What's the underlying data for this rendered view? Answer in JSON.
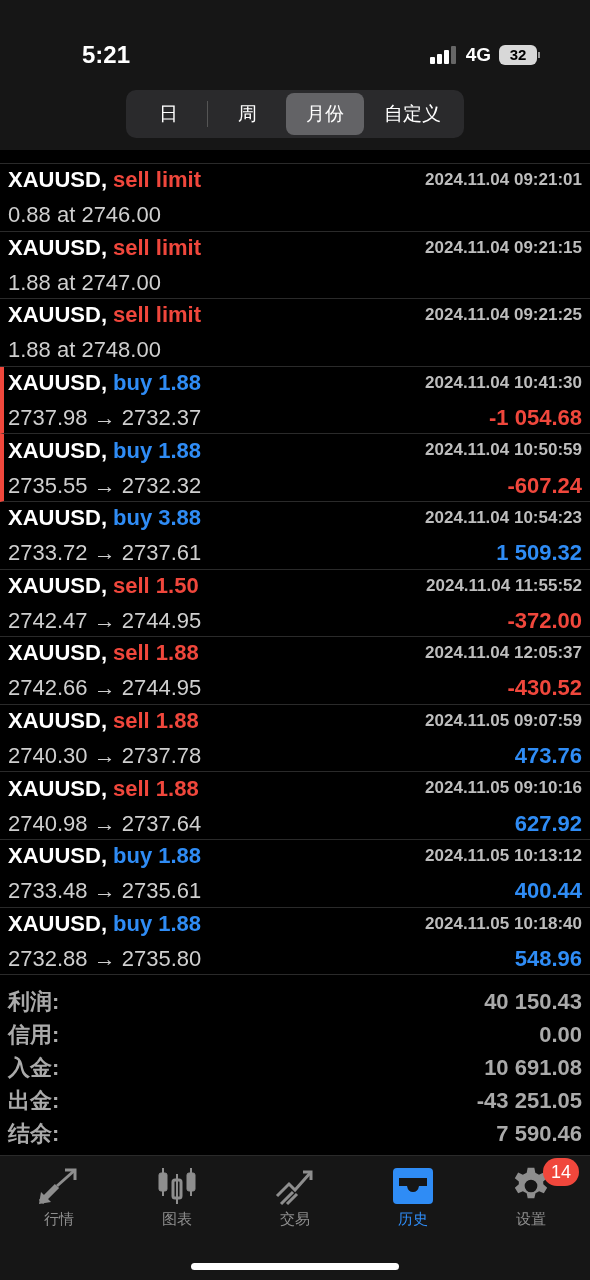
{
  "status_bar": {
    "time": "5:21",
    "network": "4G",
    "battery": "32"
  },
  "period_tabs": [
    {
      "label": "日",
      "selected": false
    },
    {
      "label": "周",
      "selected": false
    },
    {
      "label": "月份",
      "selected": true
    },
    {
      "label": "自定义",
      "selected": false
    }
  ],
  "history": [
    {
      "kind": "order",
      "symbol": "XAUUSD,",
      "action": "sell limit",
      "color": "#f0473c",
      "time": "2024.11.04 09:21:01",
      "detail": "0.88 at 2746.00",
      "flagged": false
    },
    {
      "kind": "order",
      "symbol": "XAUUSD,",
      "action": "sell limit",
      "color": "#f0473c",
      "time": "2024.11.04 09:21:15",
      "detail": "1.88 at 2747.00",
      "flagged": false
    },
    {
      "kind": "order",
      "symbol": "XAUUSD,",
      "action": "sell limit",
      "color": "#f0473c",
      "time": "2024.11.04 09:21:25",
      "detail": "1.88 at 2748.00",
      "flagged": false
    },
    {
      "kind": "deal",
      "symbol": "XAUUSD,",
      "action": "buy 1.88",
      "color": "#2f8cf5",
      "time": "2024.11.04 10:41:30",
      "detail": "2737.98 → 2732.37",
      "profit": "-1 054.68",
      "loss": true,
      "flagged": true
    },
    {
      "kind": "deal",
      "symbol": "XAUUSD,",
      "action": "buy 1.88",
      "color": "#2f8cf5",
      "time": "2024.11.04 10:50:59",
      "detail": "2735.55 → 2732.32",
      "profit": "-607.24",
      "loss": true,
      "flagged": true
    },
    {
      "kind": "deal",
      "symbol": "XAUUSD,",
      "action": "buy 3.88",
      "color": "#2f8cf5",
      "time": "2024.11.04 10:54:23",
      "detail": "2733.72 → 2737.61",
      "profit": "1 509.32",
      "loss": false,
      "flagged": false
    },
    {
      "kind": "deal",
      "symbol": "XAUUSD,",
      "action": "sell 1.50",
      "color": "#f0473c",
      "time": "2024.11.04 11:55:52",
      "detail": "2742.47 → 2744.95",
      "profit": "-372.00",
      "loss": true,
      "flagged": false
    },
    {
      "kind": "deal",
      "symbol": "XAUUSD,",
      "action": "sell 1.88",
      "color": "#f0473c",
      "time": "2024.11.04 12:05:37",
      "detail": "2742.66 → 2744.95",
      "profit": "-430.52",
      "loss": true,
      "flagged": false
    },
    {
      "kind": "deal",
      "symbol": "XAUUSD,",
      "action": "sell 1.88",
      "color": "#f0473c",
      "time": "2024.11.05 09:07:59",
      "detail": "2740.30 → 2737.78",
      "profit": "473.76",
      "loss": false,
      "flagged": false
    },
    {
      "kind": "deal",
      "symbol": "XAUUSD,",
      "action": "sell 1.88",
      "color": "#f0473c",
      "time": "2024.11.05 09:10:16",
      "detail": "2740.98 → 2737.64",
      "profit": "627.92",
      "loss": false,
      "flagged": false
    },
    {
      "kind": "deal",
      "symbol": "XAUUSD,",
      "action": "buy 1.88",
      "color": "#2f8cf5",
      "time": "2024.11.05 10:13:12",
      "detail": "2733.48 → 2735.61",
      "profit": "400.44",
      "loss": false,
      "flagged": false
    },
    {
      "kind": "deal",
      "symbol": "XAUUSD,",
      "action": "buy 1.88",
      "color": "#2f8cf5",
      "time": "2024.11.05 10:18:40",
      "detail": "2732.88 → 2735.80",
      "profit": "548.96",
      "loss": false,
      "flagged": false
    }
  ],
  "summary": [
    {
      "label": "利润:",
      "value": "40 150.43"
    },
    {
      "label": "信用:",
      "value": "0.00"
    },
    {
      "label": "入金:",
      "value": "10 691.08"
    },
    {
      "label": "出金:",
      "value": "-43 251.05"
    },
    {
      "label": "结余:",
      "value": "7 590.46"
    }
  ],
  "tab_bar": [
    {
      "kind": "quotes",
      "label": "行情",
      "selected": false
    },
    {
      "kind": "chart",
      "label": "图表",
      "selected": false
    },
    {
      "kind": "trade",
      "label": "交易",
      "selected": false
    },
    {
      "kind": "history",
      "label": "历史",
      "selected": true
    },
    {
      "kind": "settings",
      "label": "设置",
      "selected": false,
      "badge": "14"
    }
  ]
}
